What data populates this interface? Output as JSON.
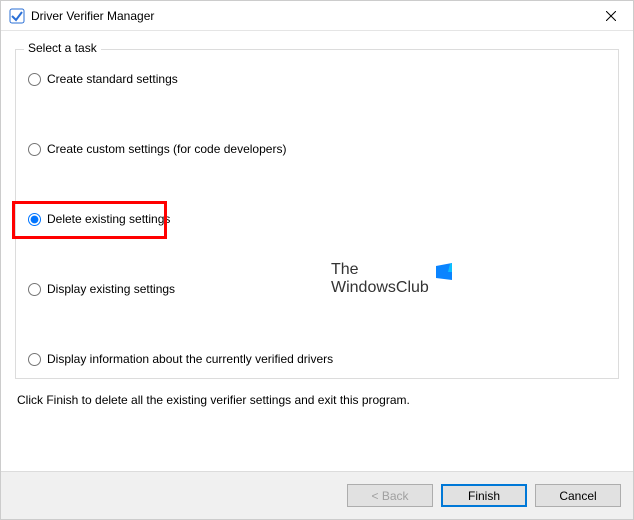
{
  "window": {
    "title": "Driver Verifier Manager"
  },
  "group": {
    "legend": "Select a task"
  },
  "options": {
    "create_standard": "Create standard settings",
    "create_custom": "Create custom settings (for code developers)",
    "delete_existing": "Delete existing settings",
    "display_existing": "Display existing settings",
    "display_info": "Display information about the currently verified drivers"
  },
  "instruction": "Click Finish to delete all the existing verifier settings and exit this program.",
  "buttons": {
    "back": "< Back",
    "finish": "Finish",
    "cancel": "Cancel"
  },
  "watermark": {
    "line1": "The",
    "line2": "WindowsClub"
  }
}
